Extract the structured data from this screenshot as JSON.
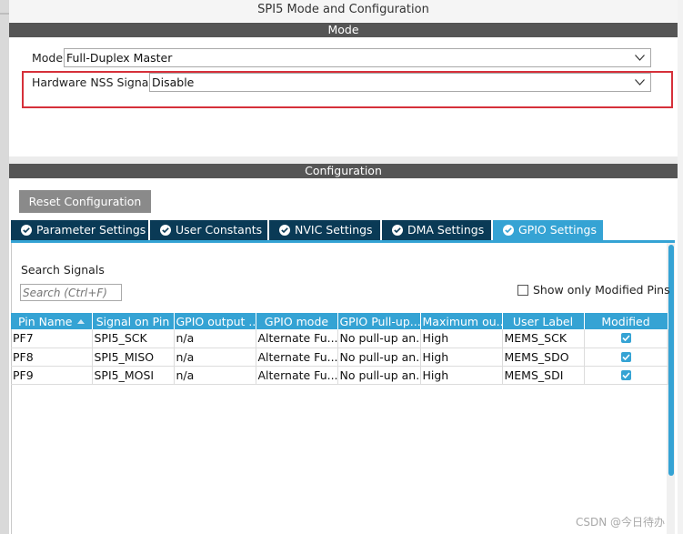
{
  "window": {
    "title": "SPI5 Mode and Configuration"
  },
  "mode_section": {
    "header": "Mode",
    "mode_label": "Mode",
    "mode_value": "Full-Duplex Master",
    "nss_label": "Hardware NSS Signal",
    "nss_value": "Disable",
    "highlight_color": "#d6303a"
  },
  "config_section": {
    "header": "Configuration",
    "reset_button": "Reset Configuration",
    "tabs": [
      {
        "label": "Parameter Settings",
        "active": false
      },
      {
        "label": "User Constants",
        "active": false
      },
      {
        "label": "NVIC Settings",
        "active": false
      },
      {
        "label": "DMA Settings",
        "active": false
      },
      {
        "label": "GPIO Settings",
        "active": true
      }
    ],
    "search": {
      "label": "Search Signals",
      "placeholder": "Search (Ctrl+F)"
    },
    "show_modified_label": "Show only Modified Pins",
    "show_modified_checked": false,
    "table": {
      "columns": [
        "Pin Name",
        "Signal on Pin",
        "GPIO output ...",
        "GPIO mode",
        "GPIO Pull-up...",
        "Maximum ou...",
        "User Label",
        "Modified"
      ],
      "rows": [
        [
          "PF7",
          "SPI5_SCK",
          "n/a",
          "Alternate Fu...",
          "No pull-up an...",
          "High",
          "MEMS_SCK",
          true
        ],
        [
          "PF8",
          "SPI5_MISO",
          "n/a",
          "Alternate Fu...",
          "No pull-up an...",
          "High",
          "MEMS_SDO",
          true
        ],
        [
          "PF9",
          "SPI5_MOSI",
          "n/a",
          "Alternate Fu...",
          "No pull-up an...",
          "High",
          "MEMS_SDI",
          true
        ]
      ]
    }
  },
  "watermark": "CSDN @今日待办",
  "colors": {
    "accent": "#35a3d4",
    "tab_inactive": "#0a3a56",
    "section_header": "#555555",
    "button": "#8a8a8a"
  }
}
